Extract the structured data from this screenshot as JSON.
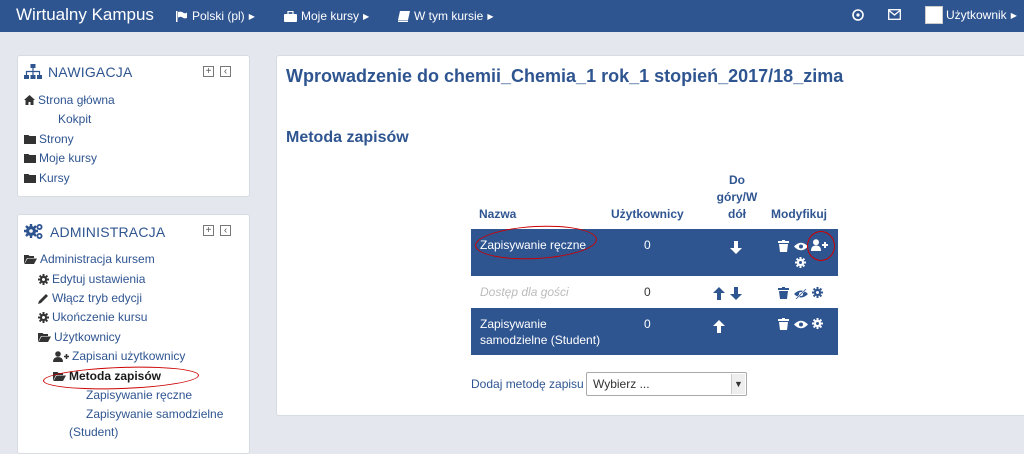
{
  "navbar": {
    "brand": "Wirtualny Kampus",
    "language": "Polski (pl)",
    "my_courses": "Moje kursy",
    "this_course": "W tym kursie",
    "user": "Użytkownik"
  },
  "navigation_block": {
    "title": "NAWIGACJA",
    "items": [
      {
        "label": "Strona główna"
      },
      {
        "label": "Kokpit"
      },
      {
        "label": "Strony"
      },
      {
        "label": "Moje kursy"
      },
      {
        "label": "Kursy"
      }
    ]
  },
  "admin_block": {
    "title": "ADMINISTRACJA",
    "items": [
      {
        "label": "Administracja kursem"
      },
      {
        "label": "Edytuj ustawienia"
      },
      {
        "label": "Włącz tryb edycji"
      },
      {
        "label": "Ukończenie kursu"
      },
      {
        "label": "Użytkownicy"
      },
      {
        "label": "Zapisani użytkownicy"
      },
      {
        "label": "Metoda zapisów"
      },
      {
        "label": "Zapisywanie ręczne"
      },
      {
        "label": "Zapisywanie samodzielne"
      },
      {
        "label": "(Student)"
      }
    ]
  },
  "main": {
    "course_title": "Wprowadzenie do chemii_Chemia_1 rok_1 stopień_2017/18_zima",
    "section_title": "Metoda zapisów",
    "table": {
      "headers": {
        "name": "Nazwa",
        "users": "Użytkownicy",
        "updown_1": "Do",
        "updown_2": "góry/W",
        "updown_3": "dół",
        "edit": "Modyfikuj"
      },
      "rows": [
        {
          "name": "Zapisywanie ręczne",
          "users": "0"
        },
        {
          "name": "Dostęp dla gości",
          "users": "0"
        },
        {
          "name_1": "Zapisywanie",
          "name_2": "samodzielne (Student)",
          "users": "0"
        }
      ]
    },
    "add_method_label": "Dodaj metodę zapisu",
    "add_method_select": "Wybierz ..."
  },
  "colors": {
    "brand": "#2f5591",
    "annotation": "#cc0000"
  }
}
